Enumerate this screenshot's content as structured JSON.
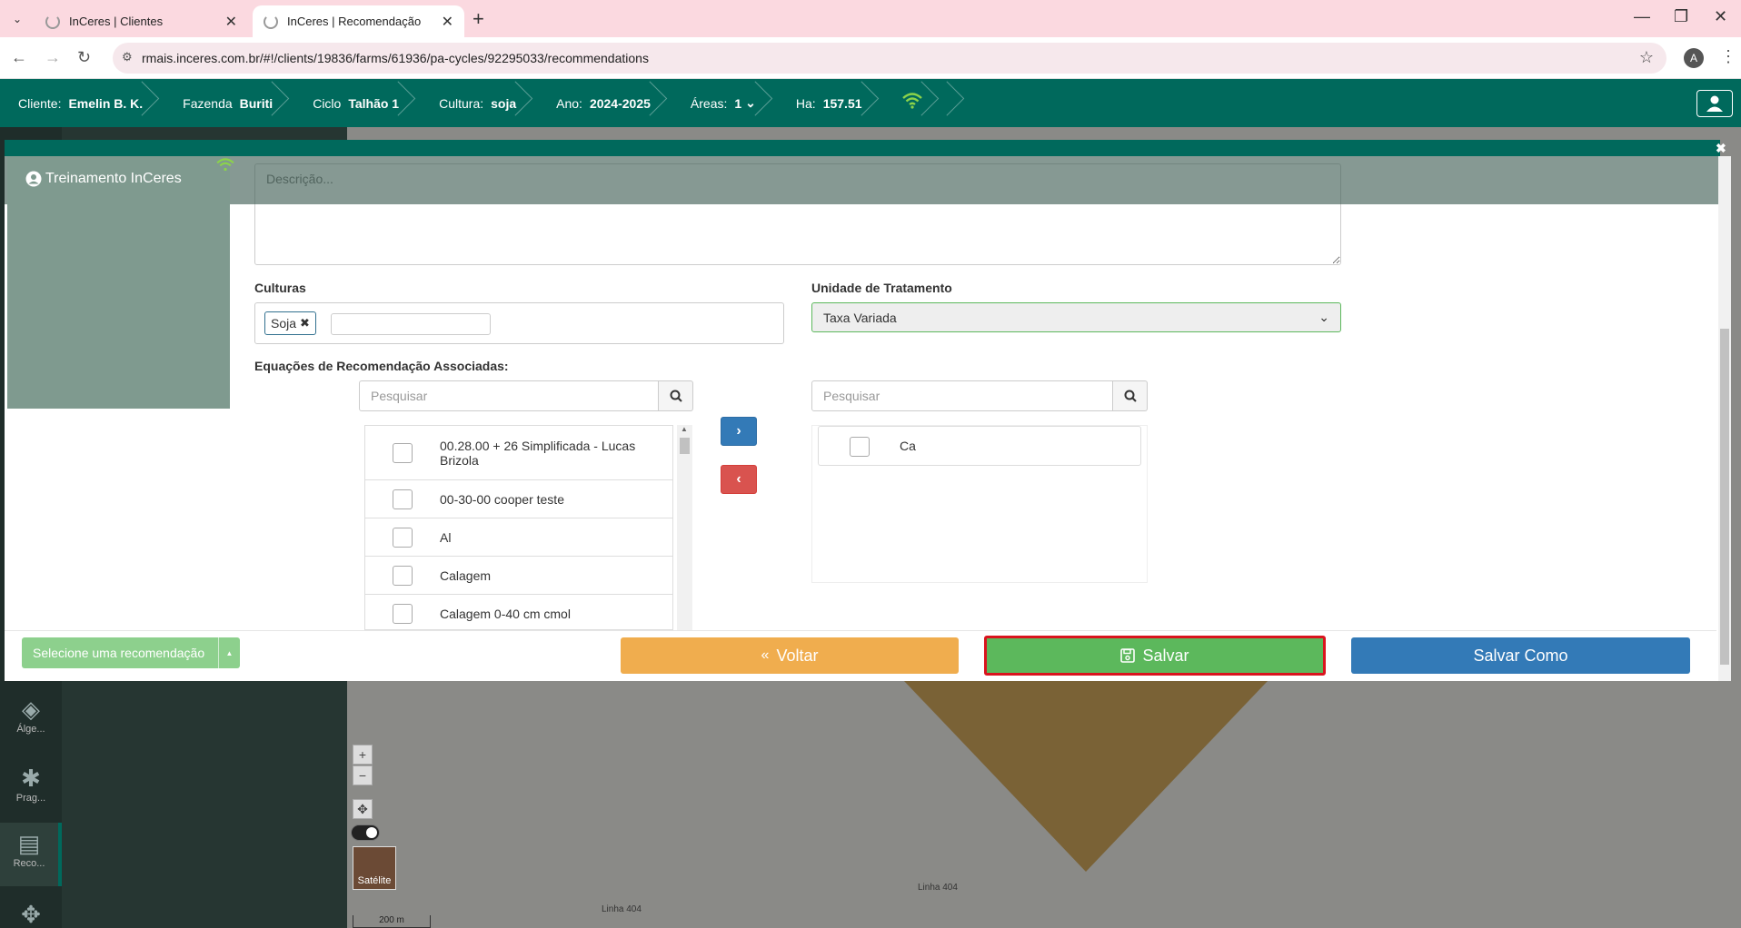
{
  "browser": {
    "tabs": [
      {
        "title": "InCeres | Clientes"
      },
      {
        "title": "InCeres | Recomendação"
      }
    ],
    "url": "rmais.inceres.com.br/#!/clients/19836/farms/61936/pa-cycles/92295033/recommendations",
    "profile_initial": "A"
  },
  "header": {
    "cliente_label": "Cliente:",
    "cliente_value": "Emelin B. K.",
    "fazenda_label": "Fazenda",
    "fazenda_value": "Buriti",
    "ciclo_label": "Ciclo",
    "ciclo_value": "Talhão 1",
    "cultura_label": "Cultura:",
    "cultura_value": "soja",
    "ano_label": "Ano:",
    "ano_value": "2024-2025",
    "areas_label": "Áreas:",
    "areas_value": "1",
    "ha_label": "Ha:",
    "ha_value": "157.51"
  },
  "user_card": {
    "name": "Treinamento InCeres"
  },
  "sidebar": {
    "items": [
      {
        "label": "Álge..."
      },
      {
        "label": "Prag..."
      },
      {
        "label": "Reco..."
      }
    ]
  },
  "map": {
    "satellite_label": "Satélite",
    "road_1": "Linha 404",
    "road_2": "Linha 404",
    "scale_label": "200 m"
  },
  "form": {
    "description_placeholder": "Descrição...",
    "culturas_label": "Culturas",
    "culture_tag": "Soja",
    "unidade_label": "Unidade de Tratamento",
    "unidade_value": "Taxa Variada",
    "equacoes_label": "Equações de Recomendação Associadas:",
    "search_left_placeholder": "Pesquisar",
    "search_right_placeholder": "Pesquisar",
    "left_items": [
      "00.28.00 + 26 Simplificada - Lucas Brizola",
      "00-30-00 cooper teste",
      "Al",
      "Calagem",
      "Calagem 0-40 cm cmol"
    ],
    "right_items": [
      "Ca"
    ]
  },
  "footer": {
    "rec_select": "Selecione uma recomendação",
    "voltar": "Voltar",
    "salvar": "Salvar",
    "salvar_como": "Salvar Como"
  },
  "colors": {
    "header_bg": "#00695c",
    "salvar_bg": "#5cb85c",
    "salvar_border": "#d9141e",
    "voltar_bg": "#f0ad4e",
    "salvar_como_bg": "#337ab7"
  }
}
